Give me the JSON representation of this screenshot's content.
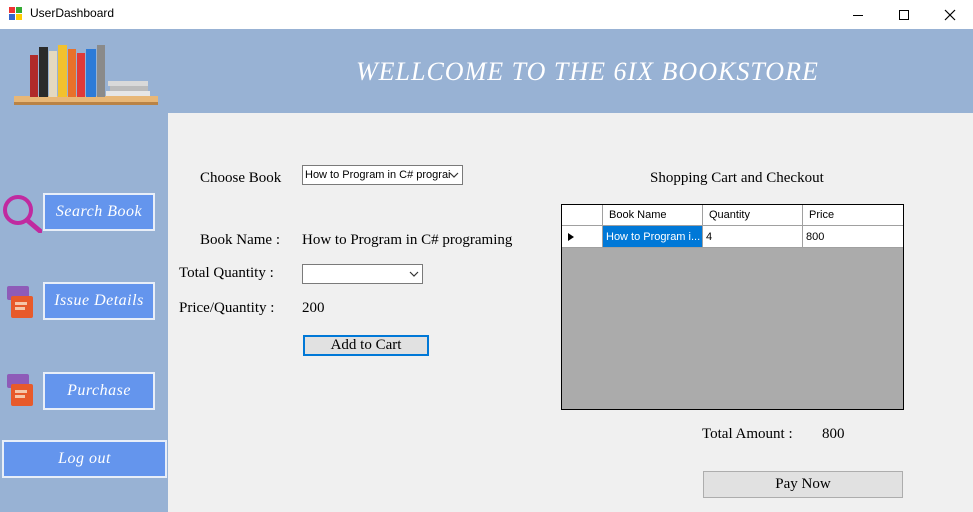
{
  "window": {
    "title": "UserDashboard"
  },
  "header": {
    "welcome_text": "WELLCOME TO THE 6IX BOOKSTORE"
  },
  "sidebar": {
    "items": [
      {
        "label": "Search Book",
        "icon": "magnifier-icon"
      },
      {
        "label": "Issue Details",
        "icon": "books-icon"
      },
      {
        "label": "Purchase",
        "icon": "books-icon"
      },
      {
        "label": "Log out"
      }
    ]
  },
  "form": {
    "choose_book_label": "Choose Book",
    "choose_book_value": "How to Program in C# prograi",
    "book_name_label": "Book Name :",
    "book_name_value": "How to Program in C# programing",
    "total_quantity_label": "Total Quantity :",
    "total_quantity_value": "",
    "price_label": "Price/Quantity :",
    "price_value": "200",
    "add_to_cart_label": "Add to Cart"
  },
  "cart": {
    "title": "Shopping Cart and Checkout",
    "columns": [
      "Book Name",
      "Quantity",
      "Price"
    ],
    "rows": [
      {
        "book_name": "How to Program i...",
        "quantity": "4",
        "price": "800"
      }
    ],
    "total_label": "Total Amount :",
    "total_value": "800",
    "pay_label": "Pay Now"
  },
  "colors": {
    "header_bg": "#98b2d4",
    "button_blue": "#6495ed",
    "selection": "#0078d7"
  }
}
